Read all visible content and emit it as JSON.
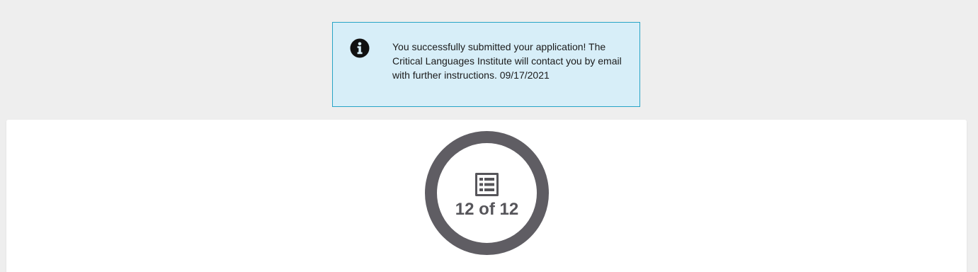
{
  "alert": {
    "icon": "info-icon",
    "message": "You successfully submitted your application! The Critical Languages Institute will contact you by email with further instructions. 09/17/2021",
    "colors": {
      "background": "#d7eef8",
      "border": "#27a4c6"
    }
  },
  "progress": {
    "icon": "list-icon",
    "label": "12 of 12",
    "completed": 12,
    "total": 12,
    "ring_color": "#5f5d63"
  }
}
